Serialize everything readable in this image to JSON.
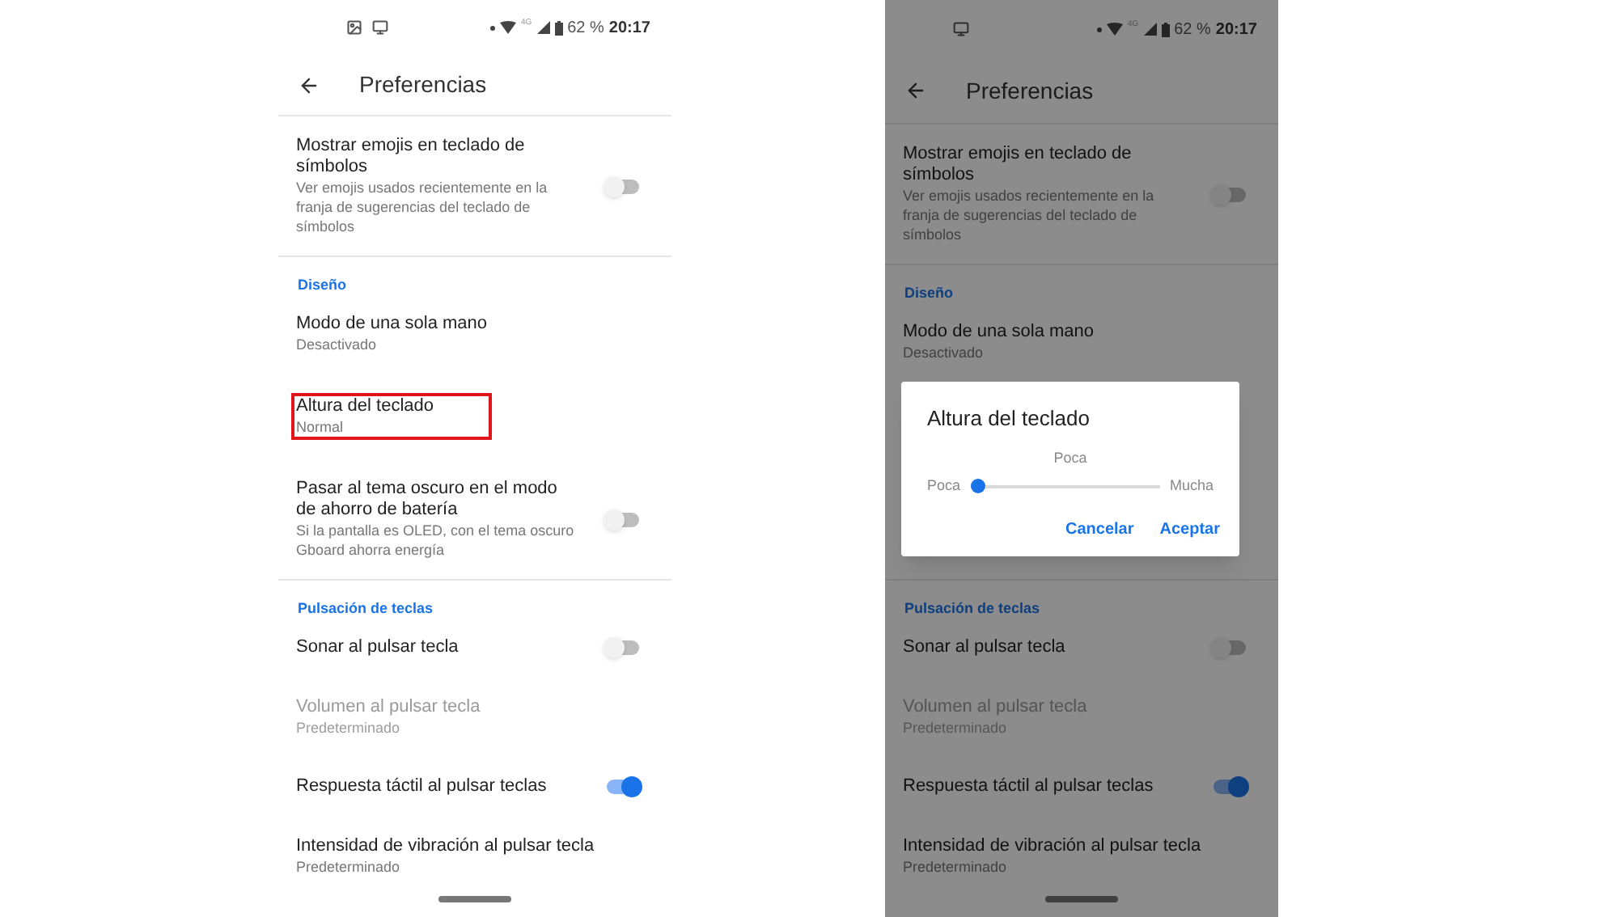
{
  "screens": [
    {
      "dimmed": false,
      "status_bar": {
        "notifications": [
          {
            "kind": "image"
          },
          {
            "kind": "monitor"
          }
        ],
        "network": "4G",
        "battery": "62 %",
        "time": "20:17"
      },
      "toolbar": {
        "title": "Preferencias"
      },
      "items": [
        {
          "kind": "switch",
          "title": "Mostrar emojis en teclado de símbolos",
          "subtitle": "Ver emojis usados recientemente en la franja de sugerencias del teclado de símbolos",
          "on": false,
          "disabled": false
        },
        {
          "kind": "divider"
        },
        {
          "kind": "header",
          "title": "Diseño"
        },
        {
          "kind": "setting",
          "title": "Modo de una sola mano",
          "subtitle": "Desactivado",
          "disabled": false,
          "highlighted": false
        },
        {
          "kind": "setting",
          "title": "Altura del teclado",
          "subtitle": "Normal",
          "disabled": false,
          "highlighted": true
        },
        {
          "kind": "switch",
          "title": "Pasar al tema oscuro en el modo de ahorro de batería",
          "subtitle": "Si la pantalla es OLED, con el tema oscuro Gboard ahorra energía",
          "on": false,
          "disabled": false
        },
        {
          "kind": "divider"
        },
        {
          "kind": "header",
          "title": "Pulsación de teclas"
        },
        {
          "kind": "switch",
          "title": "Sonar al pulsar tecla",
          "on": false,
          "disabled": false
        },
        {
          "kind": "setting",
          "title": "Volumen al pulsar tecla",
          "subtitle": "Predeterminado",
          "disabled": true,
          "highlighted": false
        },
        {
          "kind": "switch",
          "title": "Respuesta táctil al pulsar teclas",
          "on": true,
          "disabled": false
        },
        {
          "kind": "setting",
          "title": "Intensidad de vibración al pulsar tecla",
          "subtitle": "Predeterminado",
          "disabled": false,
          "highlighted": false
        }
      ]
    },
    {
      "dimmed": true,
      "status_bar": {
        "notifications": [
          {
            "kind": "monitor"
          }
        ],
        "network": "4G",
        "battery": "62 %",
        "time": "20:17"
      },
      "toolbar": {
        "title": "Preferencias"
      },
      "items": [
        {
          "kind": "switch",
          "title": "Mostrar emojis en teclado de símbolos",
          "subtitle": "Ver emojis usados recientemente en la franja de sugerencias del teclado de símbolos",
          "on": false,
          "disabled": false
        },
        {
          "kind": "divider"
        },
        {
          "kind": "header",
          "title": "Diseño"
        },
        {
          "kind": "setting",
          "title": "Modo de una sola mano",
          "subtitle": "Desactivado",
          "disabled": false,
          "highlighted": false
        },
        {
          "kind": "covered"
        },
        {
          "kind": "divider"
        },
        {
          "kind": "header",
          "title": "Pulsación de teclas"
        },
        {
          "kind": "switch",
          "title": "Sonar al pulsar tecla",
          "on": false,
          "disabled": false
        },
        {
          "kind": "setting",
          "title": "Volumen al pulsar tecla",
          "subtitle": "Predeterminado",
          "disabled": true,
          "highlighted": false
        },
        {
          "kind": "switch",
          "title": "Respuesta táctil al pulsar teclas",
          "on": true,
          "disabled": false
        },
        {
          "kind": "setting",
          "title": "Intensidad de vibración al pulsar tecla",
          "subtitle": "Predeterminado",
          "disabled": false,
          "highlighted": false
        }
      ],
      "dialog": {
        "title": "Altura del teclado",
        "value_label": "Poca",
        "min_label": "Poca",
        "max_label": "Mucha",
        "level": 0,
        "buttons": [
          "Cancelar",
          "Aceptar"
        ]
      }
    }
  ]
}
